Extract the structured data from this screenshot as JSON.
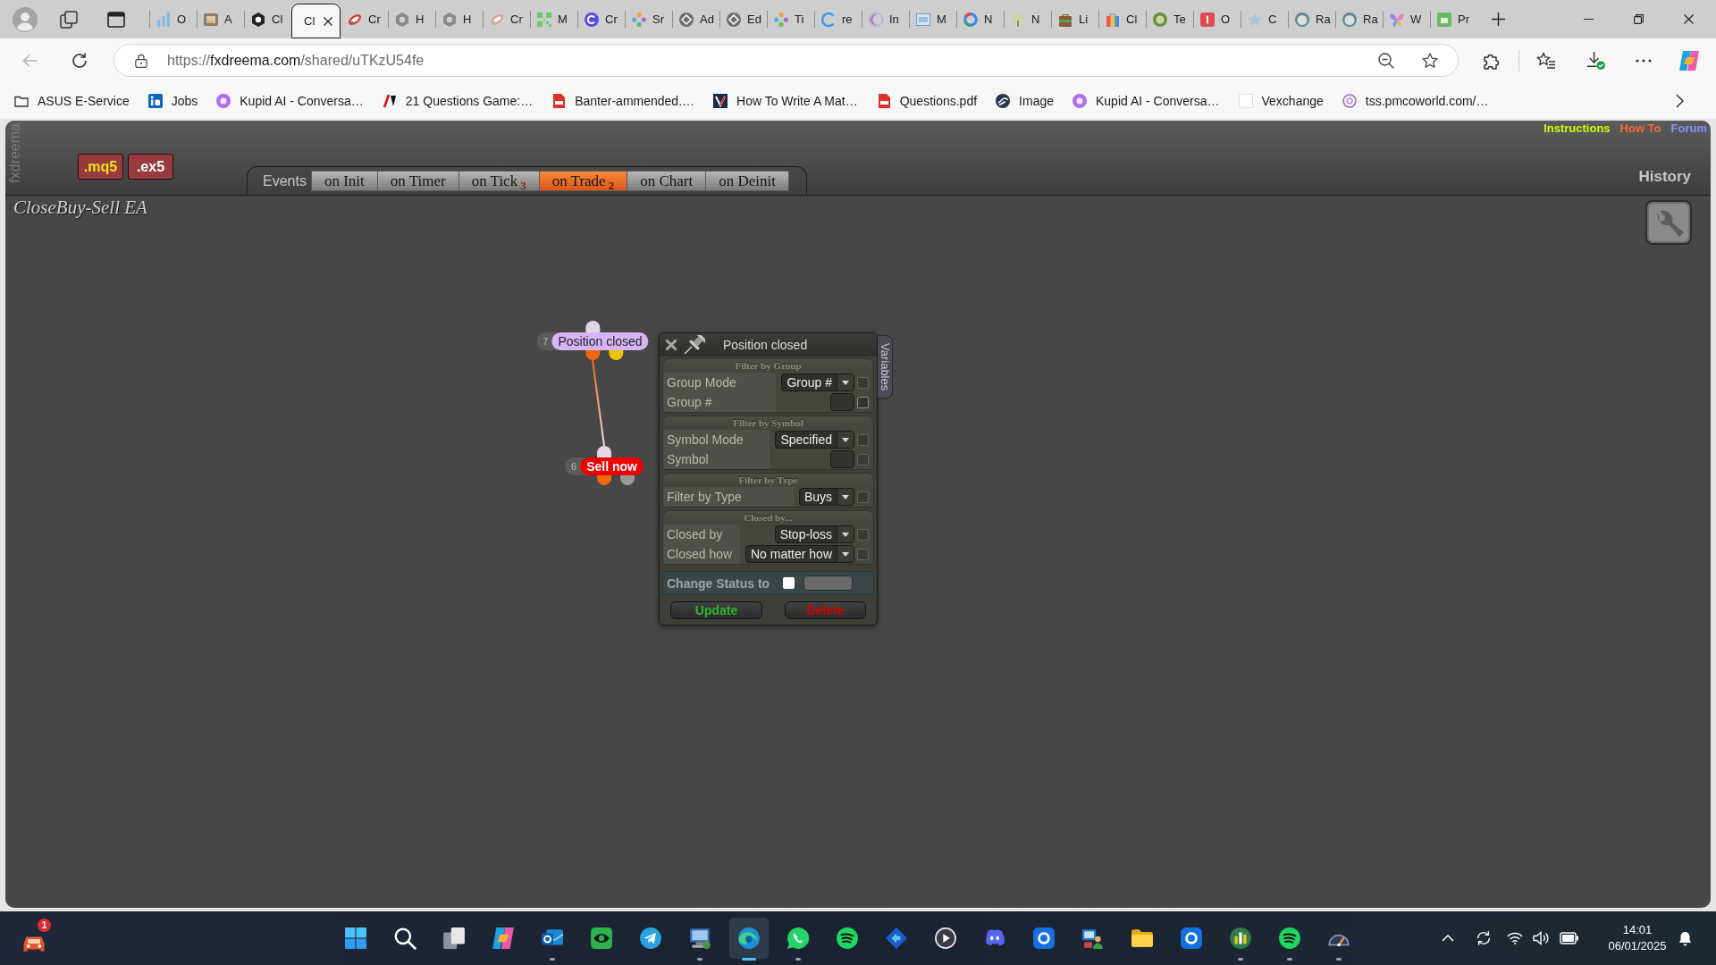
{
  "browser": {
    "tabs": [
      {
        "title": "O",
        "selected": false
      },
      {
        "title": "A",
        "selected": false
      },
      {
        "title": "Cl",
        "selected": false
      },
      {
        "title": "Cl",
        "selected": true
      },
      {
        "title": "Cr",
        "selected": false
      },
      {
        "title": "H",
        "selected": false
      },
      {
        "title": "H",
        "selected": false
      },
      {
        "title": "Cr",
        "selected": false
      },
      {
        "title": "M",
        "selected": false
      },
      {
        "title": "Cr",
        "selected": false
      },
      {
        "title": "Sr",
        "selected": false
      },
      {
        "title": "Ad",
        "selected": false
      },
      {
        "title": "Ed",
        "selected": false
      },
      {
        "title": "Ti",
        "selected": false
      },
      {
        "title": "re",
        "selected": false
      },
      {
        "title": "In",
        "selected": false
      },
      {
        "title": "M",
        "selected": false
      },
      {
        "title": "N",
        "selected": false
      },
      {
        "title": "N",
        "selected": false
      },
      {
        "title": "Li",
        "selected": false
      },
      {
        "title": "Cl",
        "selected": false
      },
      {
        "title": "Te",
        "selected": false
      },
      {
        "title": "O",
        "selected": false
      },
      {
        "title": "C",
        "selected": false
      },
      {
        "title": "Ra",
        "selected": false
      },
      {
        "title": "Ra",
        "selected": false
      },
      {
        "title": "W",
        "selected": false
      },
      {
        "title": "Pr",
        "selected": false
      }
    ],
    "back_disabled": true,
    "address": {
      "scheme": "https://",
      "host": "fxdreema.com",
      "path": "/shared/uTKzU54fe"
    },
    "bookmarks": [
      "ASUS E-Service",
      "Jobs",
      "Kupid AI - Conversa…",
      "21 Questions Game:…",
      "Banter-ammended.…",
      "How To Write A Mat…",
      "Questions.pdf",
      "Image",
      "Kupid AI - Conversa…",
      "Vexchange",
      "tss.pmcoworld.com/…"
    ]
  },
  "app": {
    "side_label": "fxdreema",
    "file_buttons": [
      {
        "label": ".mq5",
        "color": "#f2e41c"
      },
      {
        "label": ".ex5",
        "color": "#ffffff"
      }
    ],
    "events_label": "Events",
    "event_tabs": [
      {
        "label": "on Init",
        "selected": false
      },
      {
        "label": "on Timer",
        "selected": false
      },
      {
        "label": "on Tick",
        "count": "3",
        "selected": false
      },
      {
        "label": "on Trade",
        "count": "2",
        "selected": true
      },
      {
        "label": "on Chart",
        "selected": false
      },
      {
        "label": "on Deinit",
        "selected": false
      }
    ],
    "links": [
      {
        "label": "Instructions",
        "color": "#ccff00"
      },
      {
        "label": "How To",
        "color": "#ff6633"
      },
      {
        "label": "Forum",
        "color": "#8c8cff"
      }
    ],
    "history_label": "History",
    "project_title": "CloseBuy-Sell EA",
    "blocks": [
      {
        "number": "7",
        "label": "Position closed",
        "kind": "condition",
        "color": "#d6b4f7",
        "outputs": [
          {
            "color": "#f06a10"
          },
          {
            "color": "#f2c400"
          }
        ],
        "children": [
          {
            "number": "6",
            "label": "Sell now",
            "kind": "action",
            "color": "#ee0000",
            "outputs": [
              {
                "color": "#f06a10"
              },
              {
                "color": "#999999"
              }
            ]
          }
        ]
      }
    ],
    "dialog": {
      "title": "Position closed",
      "side_tab": "Variables",
      "sections": [
        {
          "title": "Filter by Group",
          "rows": [
            {
              "label": "Group Mode",
              "kind": "select",
              "value": "Group #",
              "toggle": {
                "checked": false,
                "disabled": true
              }
            },
            {
              "label": "Group #",
              "kind": "input",
              "toggle": {
                "checked": false,
                "disabled": false
              }
            }
          ]
        },
        {
          "title": "Filter by Symbol",
          "rows": [
            {
              "label": "Symbol Mode",
              "kind": "select",
              "value": "Specified",
              "toggle": {
                "checked": false,
                "disabled": true
              }
            },
            {
              "label": "Symbol",
              "kind": "input",
              "toggle": {
                "checked": false,
                "disabled": true
              }
            }
          ]
        },
        {
          "title": "Filter by Type",
          "rows": [
            {
              "label": "Filter by Type",
              "kind": "select",
              "value": "Buys",
              "toggle": {
                "checked": false,
                "disabled": true
              }
            }
          ]
        },
        {
          "title": "Closed by...",
          "rows": [
            {
              "label": "Closed by",
              "kind": "select",
              "value": "Stop-loss",
              "toggle": {
                "checked": false,
                "disabled": true
              }
            },
            {
              "label": "Closed how",
              "kind": "select",
              "value": "No matter how",
              "toggle": {
                "checked": false,
                "disabled": true
              }
            }
          ]
        }
      ],
      "status": {
        "label": "Change Status to",
        "checked": false
      },
      "buttons": [
        {
          "label": "Update",
          "kind": "update"
        },
        {
          "label": "Delete",
          "kind": "delete"
        }
      ]
    }
  },
  "taskbar": {
    "widget_badge": "1",
    "apps": [
      {
        "running": false,
        "selected": false
      },
      {
        "running": false,
        "selected": false
      },
      {
        "running": false,
        "selected": false
      },
      {
        "running": false,
        "selected": false
      },
      {
        "running": true,
        "selected": false
      },
      {
        "running": false,
        "selected": false
      },
      {
        "running": false,
        "selected": false
      },
      {
        "running": true,
        "selected": false
      },
      {
        "running": true,
        "selected": true
      },
      {
        "running": true,
        "selected": false
      },
      {
        "running": false,
        "selected": false
      },
      {
        "running": false,
        "selected": false
      },
      {
        "running": false,
        "selected": false
      },
      {
        "running": false,
        "selected": false
      },
      {
        "running": false,
        "selected": false
      },
      {
        "running": false,
        "selected": false
      },
      {
        "running": false,
        "selected": false
      },
      {
        "running": false,
        "selected": false
      },
      {
        "running": true,
        "selected": false
      },
      {
        "running": true,
        "selected": false
      },
      {
        "running": true,
        "selected": false
      }
    ],
    "time": "14:01",
    "date": "06/01/2025"
  }
}
